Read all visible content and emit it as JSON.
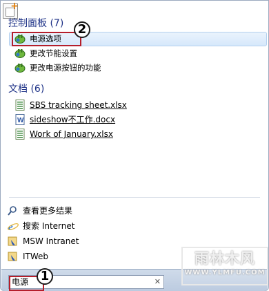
{
  "groups": {
    "control_panel": {
      "header": "控制面板 (7)",
      "items": [
        {
          "label": "电源选项",
          "icon": "power-options-icon"
        },
        {
          "label": "更改节能设置",
          "icon": "power-options-icon"
        },
        {
          "label": "更改电源按钮的功能",
          "icon": "power-options-icon"
        }
      ]
    },
    "documents": {
      "header": "文档 (6)",
      "items": [
        {
          "label": "SBS tracking sheet.xlsx",
          "icon": "excel-file-icon"
        },
        {
          "label": "sideshow不工作.docx",
          "icon": "word-file-icon"
        },
        {
          "label": "Work of January.xlsx",
          "icon": "excel-file-icon"
        }
      ]
    }
  },
  "links": [
    {
      "label": "查看更多结果",
      "icon": "search-icon"
    },
    {
      "label": "搜索 Internet",
      "icon": "internet-explorer-icon"
    },
    {
      "label": "MSW Intranet",
      "icon": "sharepoint-icon"
    },
    {
      "label": "ITWeb",
      "icon": "sharepoint-icon"
    }
  ],
  "search": {
    "value": "电源",
    "clear": "✕"
  },
  "callouts": {
    "first": "1",
    "second": "2"
  },
  "watermark": {
    "main": "雨林木风",
    "url": "WWW.YLMFU.COM"
  },
  "colors": {
    "header": "#1e3287",
    "highlight": "#d6e8fb",
    "callout_border": "#b51e2b"
  }
}
